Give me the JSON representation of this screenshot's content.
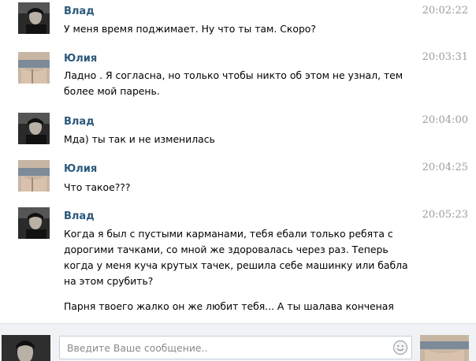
{
  "messages": [
    {
      "sender": "Влад",
      "time": "20:02:22",
      "lines": [
        "У меня время поджимает. Ну что ты там. Скоро?"
      ]
    },
    {
      "sender": "Юлия",
      "time": "20:03:31",
      "lines": [
        "Ладно . Я согласна, но только чтобы никто об этом не узнал, тем",
        "более мой парень."
      ]
    },
    {
      "sender": "Влад",
      "time": "20:04:00",
      "lines": [
        "Мда) ты так и не изменилась"
      ]
    },
    {
      "sender": "Юлия",
      "time": "20:04:25",
      "lines": [
        "Что такое???"
      ]
    },
    {
      "sender": "Влад",
      "time": "20:05:23",
      "lines": [
        "Когда я был с пустыми карманами, тебя ебали только ребята с",
        "дорогими тачками, со мной же здоровалась через раз. Теперь",
        "когда у меня куча крутых тачек, решила себе машинку или бабла",
        "на этом срубить?"
      ],
      "extra": "Парня твоего жалко он же любит тебя... А ты шалава конченая"
    }
  ],
  "composer": {
    "placeholder": "Введите Ваше сообщение.."
  },
  "icons": {
    "emoji": "smile-icon"
  },
  "colors": {
    "sender": "#2b587a",
    "time": "#9c9c9c",
    "composer_bg": "#f0f2f5"
  }
}
